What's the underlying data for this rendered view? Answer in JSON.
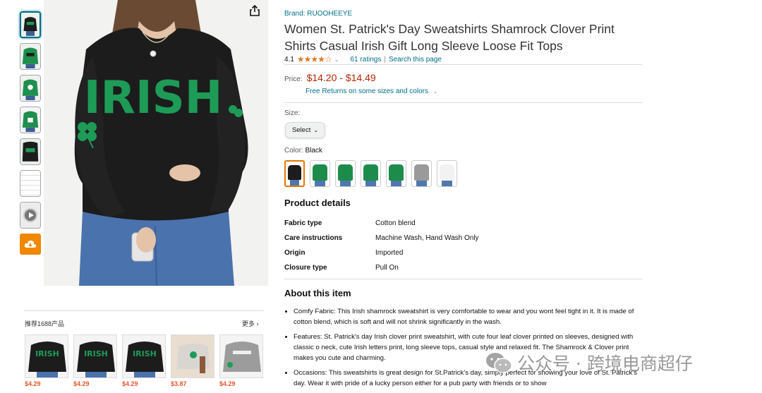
{
  "brand": "Brand: RUOOHEEYE",
  "title": "Women St. Patrick's Day Sweatshirts Shamrock Clover Print Shirts Casual Irish Gift Long Sleeve Loose Fit Tops",
  "rating": {
    "value": "4.1",
    "stars": "★★★★☆",
    "count": "61 ratings",
    "separator": "|",
    "search": "Search this page"
  },
  "price": {
    "label": "Price:",
    "range": "$14.20 - $14.49",
    "returns": "Free Returns on some sizes and colors"
  },
  "size": {
    "label": "Size:",
    "select": "Select"
  },
  "color": {
    "label": "Color:",
    "value": "Black",
    "swatches": [
      "#1c1c1c",
      "#1d8c4a",
      "#1d8c4a",
      "#1d8c4a",
      "#1d8c4a",
      "#9a9a9a",
      "#f2f2f2"
    ]
  },
  "product_details": {
    "heading": "Product details",
    "rows": [
      {
        "k": "Fabric type",
        "v": "Cotton blend"
      },
      {
        "k": "Care instructions",
        "v": "Machine Wash, Hand Wash Only"
      },
      {
        "k": "Origin",
        "v": "Imported"
      },
      {
        "k": "Closure type",
        "v": "Pull On"
      }
    ]
  },
  "about": {
    "heading": "About this item",
    "items": [
      "Comfy Fabric: This Irish shamrock sweatshirt is very comfortable to wear and you wont feel tight in it. It is made of cotton blend, which is soft and will not shrink significantly in the wash.",
      "Features: St. Patrick's day Irish clover print sweatshirt, with cute four leaf clover printed on sleeves, designed with classic o neck, cute Irish letters print, long sleeve tops, casual style and relaxed fit. The Shamrock & Clover print makes you cute and charming.",
      "Occasions: This sweatshirts is great design for St.Patrick's day, simply perfect for showing your love of St. Patrick's day. Wear it with pride of a lucky person either for a pub party with friends or to show"
    ]
  },
  "main_image": {
    "word": "IRISH"
  },
  "recommend": {
    "title": "推荐1688产品",
    "more": "更多 ›",
    "items": [
      {
        "price": "$4.29",
        "word": "IRISH"
      },
      {
        "price": "$4.29",
        "word": "IRISH"
      },
      {
        "price": "$4.29",
        "word": "IRISH"
      },
      {
        "price": "$3.87",
        "word": ""
      },
      {
        "price": "$4.29",
        "word": ""
      }
    ]
  },
  "watermark": "公众号 · 跨境电商超仔",
  "colors": {
    "accent": "#007185",
    "price": "#b12704",
    "star": "#de7921",
    "rec_price": "#e4572e",
    "orange": "#f08804",
    "shirt_green": "#1d9b57"
  }
}
